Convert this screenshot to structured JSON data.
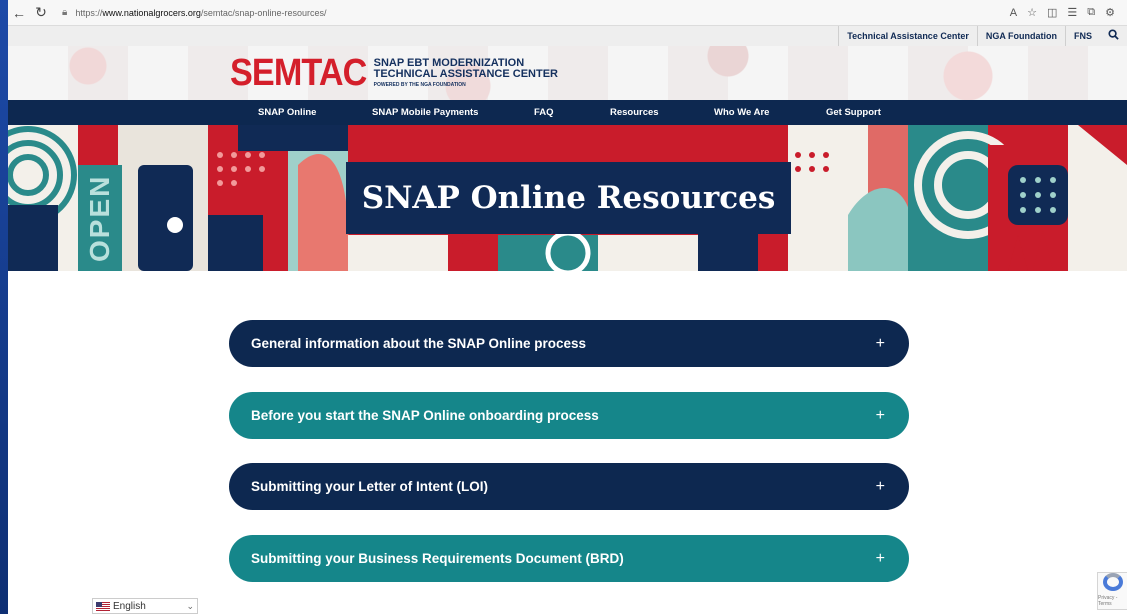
{
  "browser": {
    "url_scheme": "https://",
    "url_host": "www.nationalgrocers.org",
    "url_path": "/semtac/snap-online-resources/"
  },
  "utility_nav": {
    "items": [
      "Technical Assistance Center",
      "NGA Foundation",
      "FNS"
    ]
  },
  "logo": {
    "wordmark": "SEMTAC",
    "line1": "SNAP EBT MODERNIZATION",
    "line2": "TECHNICAL ASSISTANCE CENTER",
    "line3": "POWERED BY THE NGA FOUNDATION"
  },
  "main_nav": {
    "items": [
      "SNAP Online",
      "SNAP Mobile Payments",
      "FAQ",
      "Resources",
      "Who We Are",
      "Get Support"
    ]
  },
  "hero": {
    "title": "SNAP Online Resources",
    "open_sign": "OPEN"
  },
  "accordion": [
    {
      "label": "General information about the SNAP Online process",
      "icon": "+"
    },
    {
      "label": "Before you start the SNAP Online onboarding process",
      "icon": "+"
    },
    {
      "label": "Submitting your Letter of Intent (LOI)",
      "icon": "+"
    },
    {
      "label": "Submitting your Business Requirements Document (BRD)",
      "icon": "+"
    }
  ],
  "language": {
    "selected": "English"
  },
  "recaptcha": {
    "text": "Privacy - Terms"
  },
  "colors": {
    "navy": "#0d2850",
    "teal": "#15868a",
    "brand_red": "#d41f2b"
  }
}
